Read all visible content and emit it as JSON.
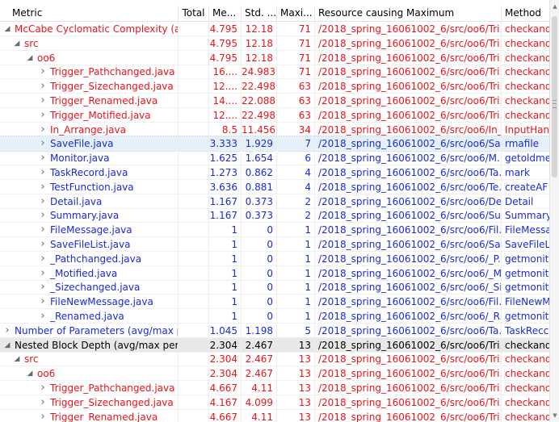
{
  "columns": [
    {
      "key": "metric",
      "label": "Metric"
    },
    {
      "key": "total",
      "label": "Total"
    },
    {
      "key": "mean",
      "label": "Me..."
    },
    {
      "key": "std",
      "label": "Std. ..."
    },
    {
      "key": "max",
      "label": "Maxi..."
    },
    {
      "key": "resource",
      "label": "Resource causing Maximum"
    },
    {
      "key": "method",
      "label": "Method"
    }
  ],
  "colors": {
    "red": "#e8141a",
    "blue": "#1a2ad9",
    "black": "#000000",
    "selected_bg": "#e6f0fa",
    "group_bg": "#e8e8e8"
  },
  "icons": {
    "expanded": "tree-expanded-icon",
    "collapsed": "tree-collapsed-icon"
  },
  "rows": [
    {
      "level": 0,
      "expanded": true,
      "color": "red",
      "name": "McCabe Cyclomatic Complexity (a",
      "total": "",
      "mean": "4.795",
      "std": "12.18",
      "max": "71",
      "resource": "/2018_spring_16061002_6/src/oo6/Tri...",
      "method": "checkand"
    },
    {
      "level": 1,
      "expanded": true,
      "color": "red",
      "name": "src",
      "total": "",
      "mean": "4.795",
      "std": "12.18",
      "max": "71",
      "resource": "/2018_spring_16061002_6/src/oo6/Tri...",
      "method": "checkand"
    },
    {
      "level": 2,
      "expanded": true,
      "color": "red",
      "name": "oo6",
      "total": "",
      "mean": "4.795",
      "std": "12.18",
      "max": "71",
      "resource": "/2018_spring_16061002_6/src/oo6/Tri...",
      "method": "checkand"
    },
    {
      "level": 3,
      "expanded": false,
      "color": "red",
      "name": "Trigger_Pathchanged.java",
      "total": "",
      "mean": "16....",
      "std": "24.983",
      "max": "71",
      "resource": "/2018_spring_16061002_6/src/oo6/Tri...",
      "method": "checkand"
    },
    {
      "level": 3,
      "expanded": false,
      "color": "red",
      "name": "Trigger_Sizechanged.java",
      "total": "",
      "mean": "12....",
      "std": "22.498",
      "max": "63",
      "resource": "/2018_spring_16061002_6/src/oo6/Tri...",
      "method": "checkand"
    },
    {
      "level": 3,
      "expanded": false,
      "color": "red",
      "name": "Trigger_Renamed.java",
      "total": "",
      "mean": "14....",
      "std": "22.088",
      "max": "63",
      "resource": "/2018_spring_16061002_6/src/oo6/Tri...",
      "method": "checkand"
    },
    {
      "level": 3,
      "expanded": false,
      "color": "red",
      "name": "Trigger_Motified.java",
      "total": "",
      "mean": "12....",
      "std": "22.498",
      "max": "63",
      "resource": "/2018_spring_16061002_6/src/oo6/Tri...",
      "method": "checkand"
    },
    {
      "level": 3,
      "expanded": false,
      "color": "red",
      "name": "In_Arrange.java",
      "total": "",
      "mean": "8.5",
      "std": "11.456",
      "max": "34",
      "resource": "/2018_spring_16061002_6/src/oo6/In_...",
      "method": "InputHan"
    },
    {
      "level": 3,
      "expanded": false,
      "color": "blue",
      "selected": true,
      "name": "SaveFile.java",
      "total": "",
      "mean": "3.333",
      "std": "1.929",
      "max": "7",
      "resource": "/2018_spring_16061002_6/src/oo6/Sa...",
      "method": "rmafile"
    },
    {
      "level": 3,
      "expanded": false,
      "color": "blue",
      "name": "Monitor.java",
      "total": "",
      "mean": "1.625",
      "std": "1.654",
      "max": "6",
      "resource": "/2018_spring_16061002_6/src/oo6/M...",
      "method": "getoldme"
    },
    {
      "level": 3,
      "expanded": false,
      "color": "blue",
      "name": "TaskRecord.java",
      "total": "",
      "mean": "1.273",
      "std": "0.862",
      "max": "4",
      "resource": "/2018_spring_16061002_6/src/oo6/Ta...",
      "method": "mark"
    },
    {
      "level": 3,
      "expanded": false,
      "color": "blue",
      "name": "TestFunction.java",
      "total": "",
      "mean": "3.636",
      "std": "0.881",
      "max": "4",
      "resource": "/2018_spring_16061002_6/src/oo6/Te...",
      "method": "createAF"
    },
    {
      "level": 3,
      "expanded": false,
      "color": "blue",
      "name": "Detail.java",
      "total": "",
      "mean": "1.167",
      "std": "0.373",
      "max": "2",
      "resource": "/2018_spring_16061002_6/src/oo6/De...",
      "method": "Detail"
    },
    {
      "level": 3,
      "expanded": false,
      "color": "blue",
      "name": "Summary.java",
      "total": "",
      "mean": "1.167",
      "std": "0.373",
      "max": "2",
      "resource": "/2018_spring_16061002_6/src/oo6/Su...",
      "method": "Summary"
    },
    {
      "level": 3,
      "expanded": false,
      "color": "blue",
      "name": "FileMessage.java",
      "total": "",
      "mean": "1",
      "std": "0",
      "max": "1",
      "resource": "/2018_spring_16061002_6/src/oo6/Fil...",
      "method": "FileMessa"
    },
    {
      "level": 3,
      "expanded": false,
      "color": "blue",
      "name": "SaveFileList.java",
      "total": "",
      "mean": "1",
      "std": "0",
      "max": "1",
      "resource": "/2018_spring_16061002_6/src/oo6/Sa...",
      "method": "SaveFileL"
    },
    {
      "level": 3,
      "expanded": false,
      "color": "blue",
      "name": "_Pathchanged.java",
      "total": "",
      "mean": "1",
      "std": "0",
      "max": "1",
      "resource": "/2018_spring_16061002_6/src/oo6/_P...",
      "method": "getmonit"
    },
    {
      "level": 3,
      "expanded": false,
      "color": "blue",
      "name": "_Motified.java",
      "total": "",
      "mean": "1",
      "std": "0",
      "max": "1",
      "resource": "/2018_spring_16061002_6/src/oo6/_M...",
      "method": "getmonit"
    },
    {
      "level": 3,
      "expanded": false,
      "color": "blue",
      "name": "_Sizechanged.java",
      "total": "",
      "mean": "1",
      "std": "0",
      "max": "1",
      "resource": "/2018_spring_16061002_6/src/oo6/_Si...",
      "method": "getmonit"
    },
    {
      "level": 3,
      "expanded": false,
      "color": "blue",
      "name": "FileNewMessage.java",
      "total": "",
      "mean": "1",
      "std": "0",
      "max": "1",
      "resource": "/2018_spring_16061002_6/src/oo6/Fil...",
      "method": "FileNewM"
    },
    {
      "level": 3,
      "expanded": false,
      "color": "blue",
      "name": "_Renamed.java",
      "total": "",
      "mean": "1",
      "std": "0",
      "max": "1",
      "resource": "/2018_spring_16061002_6/src/oo6/_R...",
      "method": "getmonit"
    },
    {
      "level": 0,
      "expanded": false,
      "color": "blue",
      "name": "Number of Parameters (avg/max p",
      "total": "",
      "mean": "1.045",
      "std": "1.198",
      "max": "5",
      "resource": "/2018_spring_16061002_6/src/oo6/Ta...",
      "method": "TaskRecc"
    },
    {
      "level": 0,
      "expanded": true,
      "color": "black",
      "grey": true,
      "name": "Nested Block Depth (avg/max per",
      "total": "",
      "mean": "2.304",
      "std": "2.467",
      "max": "13",
      "resource": "/2018_spring_16061002_6/src/oo6/Tri...",
      "method": "checkand"
    },
    {
      "level": 1,
      "expanded": true,
      "color": "red",
      "name": "src",
      "total": "",
      "mean": "2.304",
      "std": "2.467",
      "max": "13",
      "resource": "/2018_spring_16061002_6/src/oo6/Tri...",
      "method": "checkand"
    },
    {
      "level": 2,
      "expanded": true,
      "color": "red",
      "name": "oo6",
      "total": "",
      "mean": "2.304",
      "std": "2.467",
      "max": "13",
      "resource": "/2018_spring_16061002_6/src/oo6/Tri...",
      "method": "checkand"
    },
    {
      "level": 3,
      "expanded": false,
      "color": "red",
      "name": "Trigger_Pathchanged.java",
      "total": "",
      "mean": "4.667",
      "std": "4.11",
      "max": "13",
      "resource": "/2018_spring_16061002_6/src/oo6/Tri...",
      "method": "checkand"
    },
    {
      "level": 3,
      "expanded": false,
      "color": "red",
      "name": "Trigger_Sizechanged.java",
      "total": "",
      "mean": "4.167",
      "std": "4.099",
      "max": "13",
      "resource": "/2018_spring_16061002_6/src/oo6/Tri...",
      "method": "checkand"
    },
    {
      "level": 3,
      "expanded": false,
      "color": "red",
      "name": "Trigger_Renamed.java",
      "total": "",
      "mean": "4.667",
      "std": "4.11",
      "max": "13",
      "resource": "/2018_spring_16061002_6/src/oo6/Tri...",
      "method": "checkand"
    }
  ]
}
